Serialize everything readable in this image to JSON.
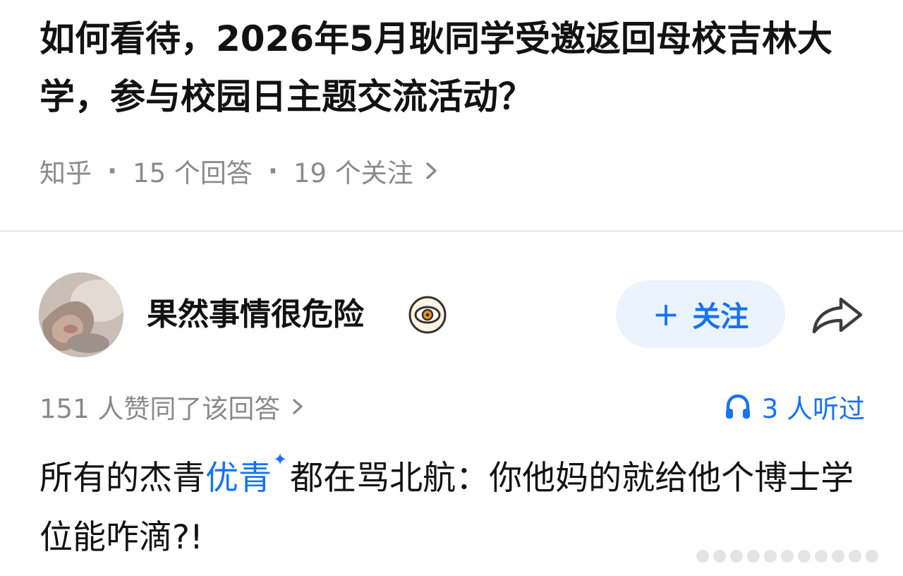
{
  "question": {
    "title": "如何看待，2026年5月耿同学受邀返回母校吉林大学，参与校园日主题交流活动？",
    "source": "知乎",
    "answers_count": "15 个回答",
    "followers_count": "19 个关注"
  },
  "author": {
    "name": "果然事情很危险",
    "follow_label": "关注"
  },
  "stats": {
    "likes_text": "151 人赞同了该回答",
    "listeners_text": "3 人听过"
  },
  "answer": {
    "text_before": "所有的杰青",
    "keyword": "优青",
    "text_after": "都在骂北航：你他妈的就给他个博士学位能咋滴?!"
  },
  "colors": {
    "accent": "#1772f6",
    "meta": "#8a8a8a",
    "text": "#121212",
    "follow_bg": "#ebf3ff"
  },
  "icons": {
    "meta_chevron": "chevron-right-icon",
    "badge": "eye-badge-icon",
    "share": "share-arrow-icon",
    "listen": "headphone-icon",
    "keyword_mark": "sparkle-icon"
  }
}
